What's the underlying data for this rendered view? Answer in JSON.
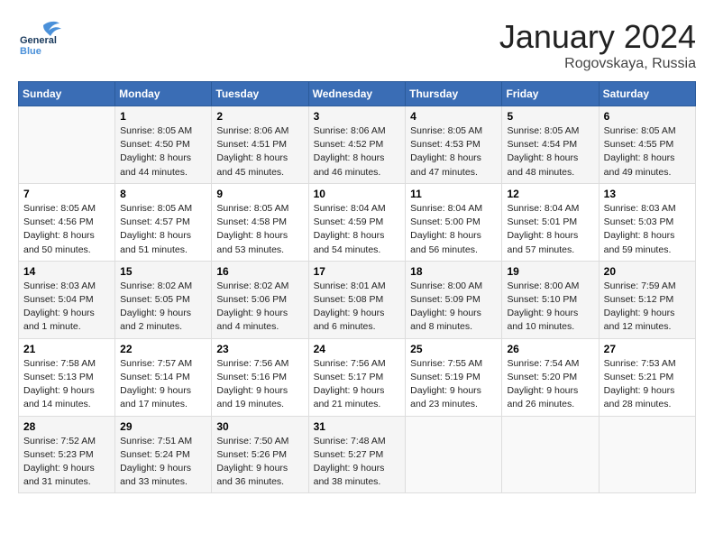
{
  "header": {
    "logo_general": "General",
    "logo_blue": "Blue",
    "month": "January 2024",
    "location": "Rogovskaya, Russia"
  },
  "days_of_week": [
    "Sunday",
    "Monday",
    "Tuesday",
    "Wednesday",
    "Thursday",
    "Friday",
    "Saturday"
  ],
  "weeks": [
    [
      {
        "day": "",
        "info": ""
      },
      {
        "day": "1",
        "info": "Sunrise: 8:05 AM\nSunset: 4:50 PM\nDaylight: 8 hours\nand 44 minutes."
      },
      {
        "day": "2",
        "info": "Sunrise: 8:06 AM\nSunset: 4:51 PM\nDaylight: 8 hours\nand 45 minutes."
      },
      {
        "day": "3",
        "info": "Sunrise: 8:06 AM\nSunset: 4:52 PM\nDaylight: 8 hours\nand 46 minutes."
      },
      {
        "day": "4",
        "info": "Sunrise: 8:05 AM\nSunset: 4:53 PM\nDaylight: 8 hours\nand 47 minutes."
      },
      {
        "day": "5",
        "info": "Sunrise: 8:05 AM\nSunset: 4:54 PM\nDaylight: 8 hours\nand 48 minutes."
      },
      {
        "day": "6",
        "info": "Sunrise: 8:05 AM\nSunset: 4:55 PM\nDaylight: 8 hours\nand 49 minutes."
      }
    ],
    [
      {
        "day": "7",
        "info": "Sunrise: 8:05 AM\nSunset: 4:56 PM\nDaylight: 8 hours\nand 50 minutes."
      },
      {
        "day": "8",
        "info": "Sunrise: 8:05 AM\nSunset: 4:57 PM\nDaylight: 8 hours\nand 51 minutes."
      },
      {
        "day": "9",
        "info": "Sunrise: 8:05 AM\nSunset: 4:58 PM\nDaylight: 8 hours\nand 53 minutes."
      },
      {
        "day": "10",
        "info": "Sunrise: 8:04 AM\nSunset: 4:59 PM\nDaylight: 8 hours\nand 54 minutes."
      },
      {
        "day": "11",
        "info": "Sunrise: 8:04 AM\nSunset: 5:00 PM\nDaylight: 8 hours\nand 56 minutes."
      },
      {
        "day": "12",
        "info": "Sunrise: 8:04 AM\nSunset: 5:01 PM\nDaylight: 8 hours\nand 57 minutes."
      },
      {
        "day": "13",
        "info": "Sunrise: 8:03 AM\nSunset: 5:03 PM\nDaylight: 8 hours\nand 59 minutes."
      }
    ],
    [
      {
        "day": "14",
        "info": "Sunrise: 8:03 AM\nSunset: 5:04 PM\nDaylight: 9 hours\nand 1 minute."
      },
      {
        "day": "15",
        "info": "Sunrise: 8:02 AM\nSunset: 5:05 PM\nDaylight: 9 hours\nand 2 minutes."
      },
      {
        "day": "16",
        "info": "Sunrise: 8:02 AM\nSunset: 5:06 PM\nDaylight: 9 hours\nand 4 minutes."
      },
      {
        "day": "17",
        "info": "Sunrise: 8:01 AM\nSunset: 5:08 PM\nDaylight: 9 hours\nand 6 minutes."
      },
      {
        "day": "18",
        "info": "Sunrise: 8:00 AM\nSunset: 5:09 PM\nDaylight: 9 hours\nand 8 minutes."
      },
      {
        "day": "19",
        "info": "Sunrise: 8:00 AM\nSunset: 5:10 PM\nDaylight: 9 hours\nand 10 minutes."
      },
      {
        "day": "20",
        "info": "Sunrise: 7:59 AM\nSunset: 5:12 PM\nDaylight: 9 hours\nand 12 minutes."
      }
    ],
    [
      {
        "day": "21",
        "info": "Sunrise: 7:58 AM\nSunset: 5:13 PM\nDaylight: 9 hours\nand 14 minutes."
      },
      {
        "day": "22",
        "info": "Sunrise: 7:57 AM\nSunset: 5:14 PM\nDaylight: 9 hours\nand 17 minutes."
      },
      {
        "day": "23",
        "info": "Sunrise: 7:56 AM\nSunset: 5:16 PM\nDaylight: 9 hours\nand 19 minutes."
      },
      {
        "day": "24",
        "info": "Sunrise: 7:56 AM\nSunset: 5:17 PM\nDaylight: 9 hours\nand 21 minutes."
      },
      {
        "day": "25",
        "info": "Sunrise: 7:55 AM\nSunset: 5:19 PM\nDaylight: 9 hours\nand 23 minutes."
      },
      {
        "day": "26",
        "info": "Sunrise: 7:54 AM\nSunset: 5:20 PM\nDaylight: 9 hours\nand 26 minutes."
      },
      {
        "day": "27",
        "info": "Sunrise: 7:53 AM\nSunset: 5:21 PM\nDaylight: 9 hours\nand 28 minutes."
      }
    ],
    [
      {
        "day": "28",
        "info": "Sunrise: 7:52 AM\nSunset: 5:23 PM\nDaylight: 9 hours\nand 31 minutes."
      },
      {
        "day": "29",
        "info": "Sunrise: 7:51 AM\nSunset: 5:24 PM\nDaylight: 9 hours\nand 33 minutes."
      },
      {
        "day": "30",
        "info": "Sunrise: 7:50 AM\nSunset: 5:26 PM\nDaylight: 9 hours\nand 36 minutes."
      },
      {
        "day": "31",
        "info": "Sunrise: 7:48 AM\nSunset: 5:27 PM\nDaylight: 9 hours\nand 38 minutes."
      },
      {
        "day": "",
        "info": ""
      },
      {
        "day": "",
        "info": ""
      },
      {
        "day": "",
        "info": ""
      }
    ]
  ]
}
